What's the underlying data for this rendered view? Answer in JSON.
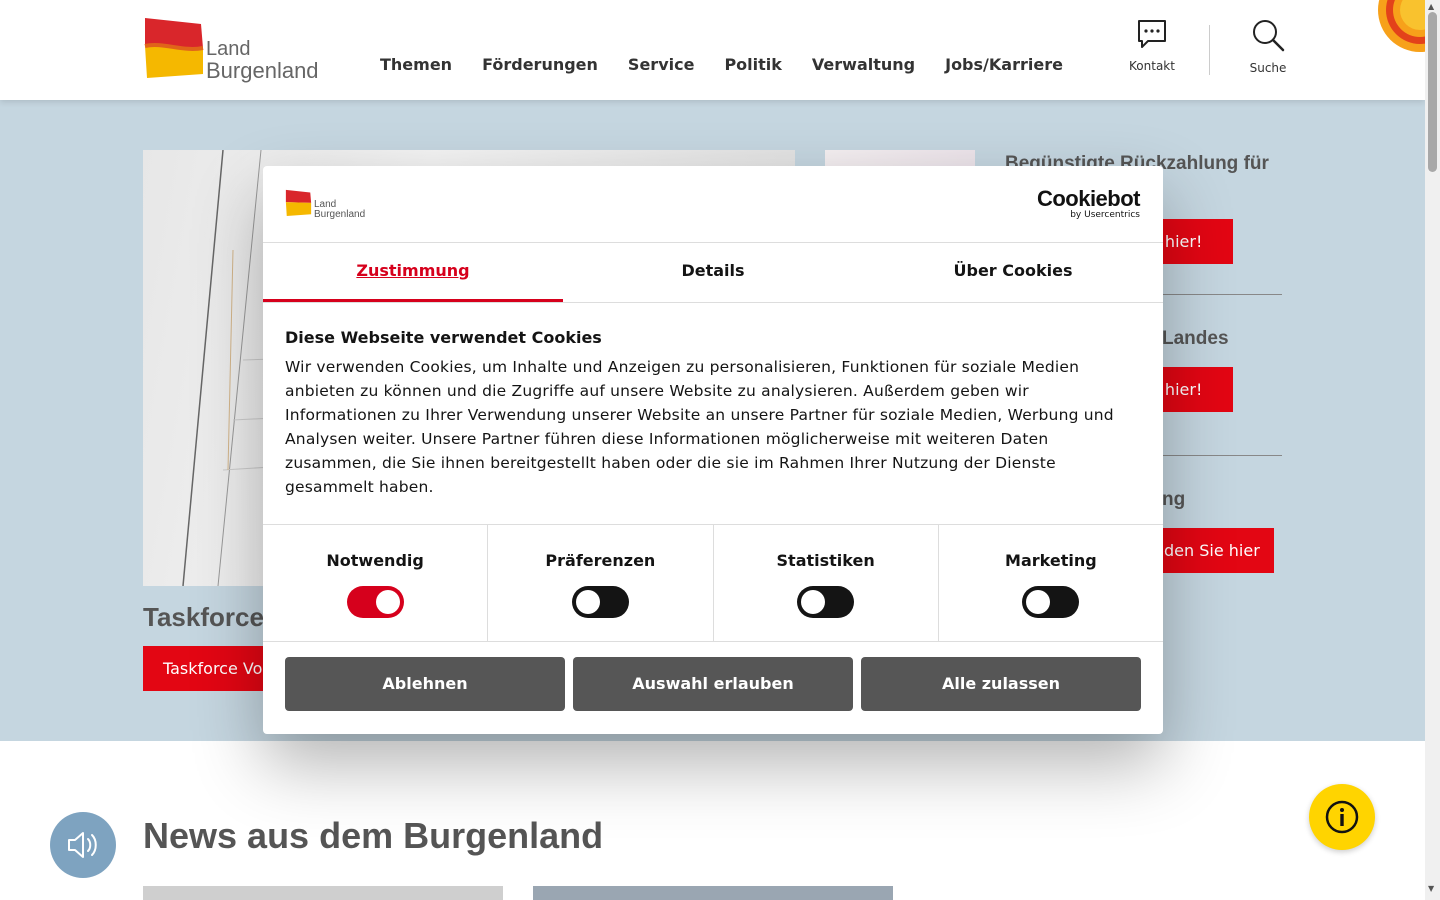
{
  "header": {
    "logo_line1": "Land",
    "logo_line2": "Burgenland",
    "nav": [
      "Themen",
      "Förderungen",
      "Service",
      "Politik",
      "Verwaltung",
      "Jobs/Karriere"
    ],
    "kontakt_label": "Kontakt",
    "suche_label": "Suche"
  },
  "hero": {
    "main_title": "Taskforce \"",
    "main_button": "Taskforce Vor",
    "side_items": [
      {
        "title": "Begünstigte Rückzahlung für",
        "button": "e hier!"
      },
      {
        "title": "Landes",
        "button": "e hier!"
      },
      {
        "title": "ng",
        "button": "den Sie hier"
      }
    ]
  },
  "news": {
    "title": "News aus dem Burgenland"
  },
  "cookie_dialog": {
    "logo_line1": "Land",
    "logo_line2": "Burgenland",
    "brand": "Cookiebot",
    "brand_sub": "by Usercentrics",
    "tabs": [
      "Zustimmung",
      "Details",
      "Über Cookies"
    ],
    "active_tab": "Zustimmung",
    "heading": "Diese Webseite verwendet Cookies",
    "text": "Wir verwenden Cookies, um Inhalte und Anzeigen zu personalisieren, Funktionen für soziale Medien anbieten zu können und die Zugriffe auf unsere Website zu analysieren. Außerdem geben wir Informationen zu Ihrer Verwendung unserer Website an unsere Partner für soziale Medien, Werbung und Analysen weiter. Unsere Partner führen diese Informationen möglicherweise mit weiteren Daten zusammen, die Sie ihnen bereitgestellt haben oder die sie im Rahmen Ihrer Nutzung der Dienste gesammelt haben.",
    "categories": [
      {
        "name": "Notwendig",
        "enabled": true
      },
      {
        "name": "Präferenzen",
        "enabled": false
      },
      {
        "name": "Statistiken",
        "enabled": false
      },
      {
        "name": "Marketing",
        "enabled": false
      }
    ],
    "buttons": {
      "decline": "Ablehnen",
      "allow_selection": "Auswahl erlauben",
      "allow_all": "Alle zulassen"
    }
  },
  "colors": {
    "accent_red": "#e30613",
    "hero_bg": "#c5d6e0",
    "info_yellow": "#ffd400",
    "audio_blue": "#7ea3c0"
  },
  "icons": [
    "chat-icon",
    "search-icon",
    "speaker-icon",
    "info-icon"
  ]
}
